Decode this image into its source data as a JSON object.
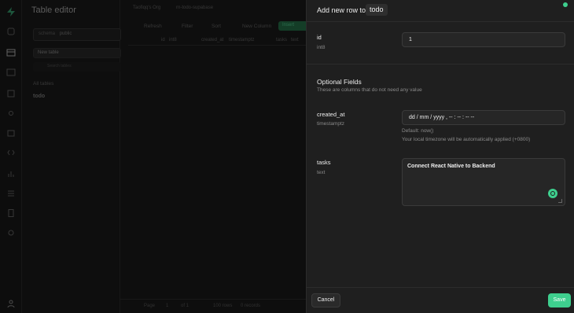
{
  "app": {
    "title": "Table editor",
    "org": "Taofiqq's Org",
    "project": "rn-todo-supabase"
  },
  "sidebar": {
    "schema_label": "schema",
    "schema_value": "public",
    "new_table": "New table",
    "search_placeholder": "Search tables",
    "all_tables": "All tables",
    "tables": [
      "todo"
    ]
  },
  "toolbar": {
    "refresh": "Refresh",
    "filter": "Filter",
    "sort": "Sort",
    "new_column": "New Column",
    "insert": "Insert"
  },
  "grid": {
    "columns": [
      {
        "name": "id",
        "type": "int8"
      },
      {
        "name": "created_at",
        "type": "timestamptz"
      },
      {
        "name": "tasks",
        "type": "text"
      }
    ]
  },
  "footer": {
    "page_label": "Page",
    "page_value": "1",
    "of_label": "of 1",
    "rows": "100 rows",
    "records": "0 records"
  },
  "panel": {
    "title": "Add new row to",
    "table_name": "todo",
    "fields": {
      "id": {
        "name": "id",
        "type": "int8",
        "value": "1"
      },
      "created_at": {
        "name": "created_at",
        "type": "timestamptz",
        "placeholder": "dd / mm / yyyy ,  -- : -- : --   --",
        "default_hint": "Default: now()",
        "timezone_hint": "Your local timezone will be automatically applied (+0800)"
      },
      "tasks": {
        "name": "tasks",
        "type": "text",
        "value": "Connect React Native to Backend"
      }
    },
    "optional_title": "Optional Fields",
    "optional_subtitle": "These are columns that do not need any value",
    "cancel": "Cancel",
    "save": "Save"
  },
  "colors": {
    "brand": "#3ecf8e",
    "panel_bg": "#1f1f1f",
    "app_bg": "#161616"
  }
}
